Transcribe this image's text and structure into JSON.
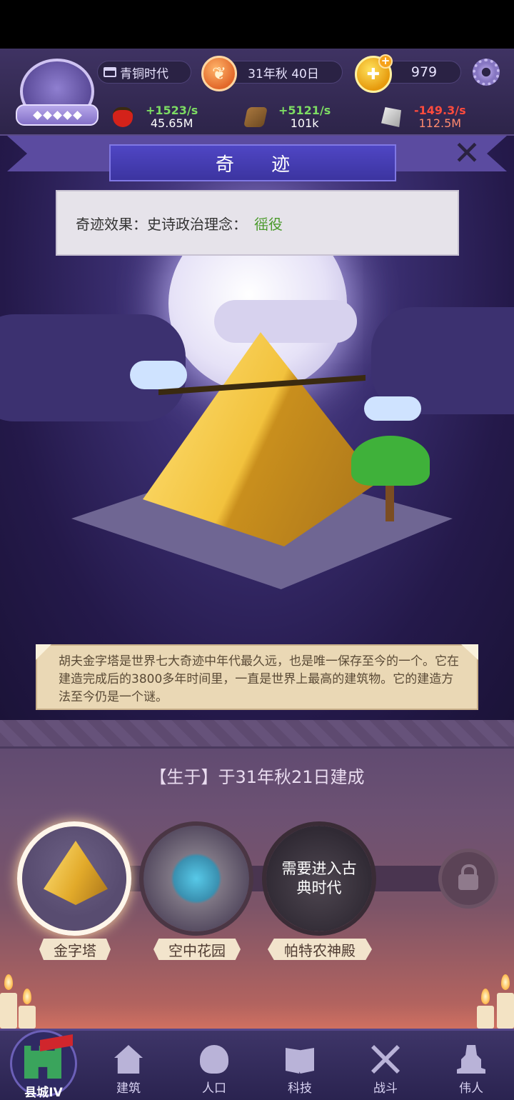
{
  "hud": {
    "era": "青铜时代",
    "date": "31年秋 40日",
    "coins": "979",
    "resources": [
      {
        "name": "food",
        "rate": "+1523/s",
        "amount": "45.65M",
        "trend": "positive"
      },
      {
        "name": "wood",
        "rate": "+5121/s",
        "amount": "101k",
        "trend": "positive"
      },
      {
        "name": "stone",
        "rate": "-149.3/s",
        "amount": "112.5M",
        "trend": "negative"
      }
    ]
  },
  "scene": {
    "title": "奇 迹",
    "effect_label": "奇迹效果：史诗政治理念：",
    "effect_value": "徭役",
    "description": "胡夫金字塔是世界七大奇迹中年代最久远，也是唯一保存至今的一个。它在建造完成后的3800多年时间里，一直是世界上最高的建筑物。它的建造方法至今仍是一个谜。"
  },
  "wonders": {
    "built_text": "【生于】于31年秋21日建成",
    "items": [
      {
        "label": "金字塔",
        "state": "selected"
      },
      {
        "label": "空中花园",
        "state": "available"
      },
      {
        "label": "帕特农神殿",
        "state": "locked-era",
        "lock_text": "需要进入古典时代"
      }
    ]
  },
  "nav": {
    "items": [
      "县城IV",
      "建筑",
      "人口",
      "科技",
      "战斗",
      "伟人"
    ]
  },
  "colors": {
    "positive": "#7ddc63",
    "negative": "#ff4b3d",
    "effect_value": "#4b9a2c",
    "title_plate": "#4f46c4"
  }
}
